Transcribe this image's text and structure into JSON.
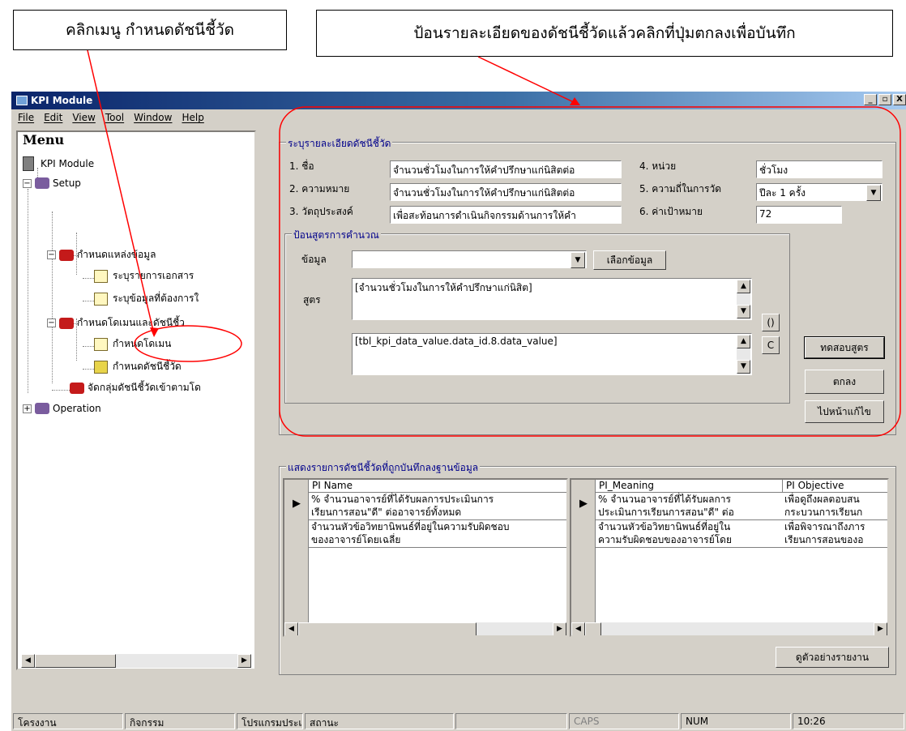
{
  "annotations": {
    "callout_left": "คลิกเมนู กำหนดดัชนีชี้วัด",
    "callout_right": "ป้อนรายละเอียดของดัชนีชี้วัดแล้วคลิกที่ปุ่มตกลงเพื่อบันทึก",
    "highlight_color": "#ff0000"
  },
  "window": {
    "title": "KPI Module",
    "controls": [
      "_",
      "▫",
      "X"
    ]
  },
  "menubar": [
    "File",
    "Edit",
    "View",
    "Tool",
    "Window",
    "Help"
  ],
  "menu_panel": {
    "title": "Menu",
    "tree": {
      "root": "KPI Module",
      "setup": "Setup",
      "data_source": "กำหนดแหล่งข้อมูล",
      "doc_list": "ระบุรายการเอกสาร",
      "data_needed": "ระบุข้อมูลที่ต้องการใ",
      "domain_kpi": "กำหนดโดเมนและดัชนีชี้ว",
      "domain": "กำหนดโดเมน",
      "kpi": "กำหนดดัชนีชี้วัด",
      "group_kpi": "จัดกลุ่มดัชนีชี้วัดเข้าตามโด",
      "operation": "Operation"
    }
  },
  "kpi_form": {
    "legend": "ระบุรายละเอียดดัชนีชี้วัด",
    "fields": {
      "name_label": "1. ชื่อ",
      "name_value": "จำนวนชั่วโมงในการให้คำปรึกษาแก่นิสิตต่อ",
      "meaning_label": "2. ความหมาย",
      "meaning_value": "จำนวนชั่วโมงในการให้คำปรึกษาแก่นิสิตต่อ",
      "objective_label": "3. วัตถุประสงค์",
      "objective_value": "เพื่อสะท้อนการดำเนินกิจกรรมด้านการให้คำ",
      "unit_label": "4. หน่วย",
      "unit_value": "ชั่วโมง",
      "frequency_label": "5. ความถี่ในการวัด",
      "frequency_value": "ปีละ 1 ครั้ง",
      "target_label": "6. ค่าเป้าหมาย",
      "target_value": "72"
    },
    "formula": {
      "legend": "ป้อนสูตรการคำนวณ",
      "data_label": "ข้อมูล",
      "data_value": "",
      "select_data_button": "เลือกข้อมูล",
      "formula_label": "สูตร",
      "formula_text": "[จำนวนชั่วโมงในการให้คำปรึกษาแก่นิสิต]",
      "formula_code": "[tbl_kpi_data_value.data_id.8.data_value]",
      "paren_button": "()",
      "clear_button": "C"
    },
    "buttons": {
      "test_formula": "ทดสอบสูตร",
      "ok": "ตกลง",
      "edit_page": "ไปหน้าแก้ไข"
    }
  },
  "kpi_list": {
    "legend": "แสดงรายการดัชนีชี้วัดที่ถูกบันทึกลงฐานข้อมูล",
    "left_columns": [
      "PI Name"
    ],
    "right_columns": [
      "PI_Meaning",
      "PI Objective"
    ],
    "rows": [
      {
        "name_line1": "% จำนวนอาจารย์ที่ได้รับผลการประเมินการ",
        "name_line2": "เรียนการสอน\"ดี\" ต่ออาจารย์ทั้งหมด",
        "meaning_line1": "% จำนวนอาจารย์ที่ได้รับผลการ",
        "meaning_line2": "ประเมินการเรียนการสอน\"ดี\" ต่อ",
        "objective_line1": "เพื่อดูถึงผลตอบสน",
        "objective_line2": "กระบวนการเรียนก"
      },
      {
        "name_line1": "จำนวนหัวข้อวิทยานิพนธ์ที่อยู่ในความรับผิดชอบ",
        "name_line2": "ของอาจารย์โดยเฉลี่ย",
        "meaning_line1": "จำนวนหัวข้อวิทยานิพนธ์ที่อยู่ใน",
        "meaning_line2": "ความรับผิดชอบของอาจารย์โดย",
        "objective_line1": "เพื่อพิจารณาถึงภาร",
        "objective_line2": "เรียนการสอนของอ"
      }
    ],
    "report_button": "ดูตัวอย่างรายงาน"
  },
  "statusbar": [
    "โครงงาน",
    "กิจกรรม",
    "โปรแกรมประเภท",
    "สถานะ",
    "",
    "CAPS",
    "NUM",
    "10:26"
  ]
}
